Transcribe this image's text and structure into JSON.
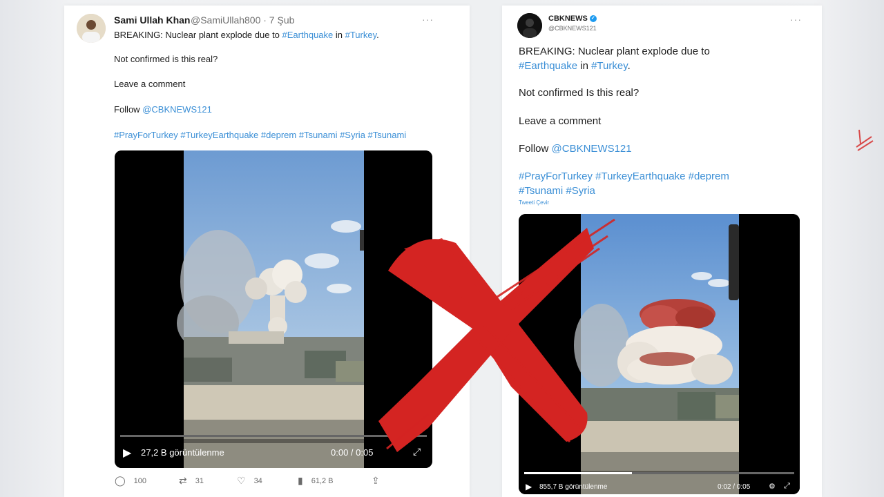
{
  "left_tweet": {
    "author_name": "Sami Ullah Khan",
    "handle_date": "@SamiUllah800 · 7 Şub",
    "line1_prefix": "BREAKING: Nuclear plant explode due to ",
    "line1_tag1": "#Earthquake",
    "line1_mid": " in ",
    "line1_tag2": "#Turkey",
    "line1_suffix": ".",
    "line2": "Not confirmed is this real?",
    "line3": "Leave a comment",
    "follow_prefix": "Follow ",
    "follow_handle": "@CBKNEWS121",
    "hashtags": "#PrayForTurkey #TurkeyEarthquake #deprem #Tsunami #Syria #Tsunami",
    "video": {
      "views": "27,2 B görüntülenme",
      "time": "0:00 / 0:05"
    },
    "actions": {
      "replies": "100",
      "retweets": "31",
      "likes": "34",
      "views": "61,2 B"
    }
  },
  "right_tweet": {
    "author_name": "CBKNEWS",
    "handle": "@CBKNEWS121",
    "line1": "BREAKING: Nuclear plant explode due to",
    "line2_tag1": "#Earthquake",
    "line2_mid": " in ",
    "line2_tag2": "#Turkey",
    "line2_suffix": ".",
    "line3": "Not confirmed Is this real?",
    "line4": "Leave a comment",
    "follow_prefix": "Follow ",
    "follow_handle": "@CBKNEWS121",
    "hashtags_1": "#PrayForTurkey #TurkeyEarthquake #deprem",
    "hashtags_2": "#Tsunami #Syria",
    "translate": "Tweeti Çevir",
    "video": {
      "views": "855,7 B görüntülenme",
      "time": "0:02 / 0:05"
    }
  },
  "colors": {
    "link": "#3b8fd6",
    "verified": "#1d9bf0",
    "cross": "#d42422"
  }
}
